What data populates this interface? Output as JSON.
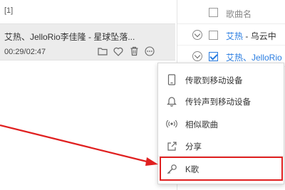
{
  "marker": "[1]",
  "now_playing": {
    "title": "艾热、JelloRio李佳隆 - 星球坠落...",
    "time": "00:29/02:47",
    "actions": [
      {
        "icon": "folder-icon"
      },
      {
        "icon": "heart-icon"
      },
      {
        "icon": "trash-icon"
      },
      {
        "icon": "more-icon"
      }
    ]
  },
  "song_list": {
    "header_label": "歌曲名",
    "rows": [
      {
        "artist": "艾热",
        "sep": " - ",
        "song": "乌云中",
        "checked": false
      },
      {
        "artist": "艾热、JelloRio",
        "sep": "",
        "song": "",
        "checked": true
      }
    ]
  },
  "context_menu": {
    "items": [
      {
        "label": "传歌到移动设备",
        "icon": "phone-icon"
      },
      {
        "label": "传铃声到移动设备",
        "icon": "bell-icon"
      },
      {
        "label": "相似歌曲",
        "icon": "radio-icon"
      },
      {
        "label": "分享",
        "icon": "share-icon"
      },
      {
        "label": "K歌",
        "icon": "microphone-icon"
      }
    ]
  },
  "colors": {
    "accent": "#2a7de1",
    "annotation": "#e02020",
    "selected_bg": "#ececec"
  }
}
